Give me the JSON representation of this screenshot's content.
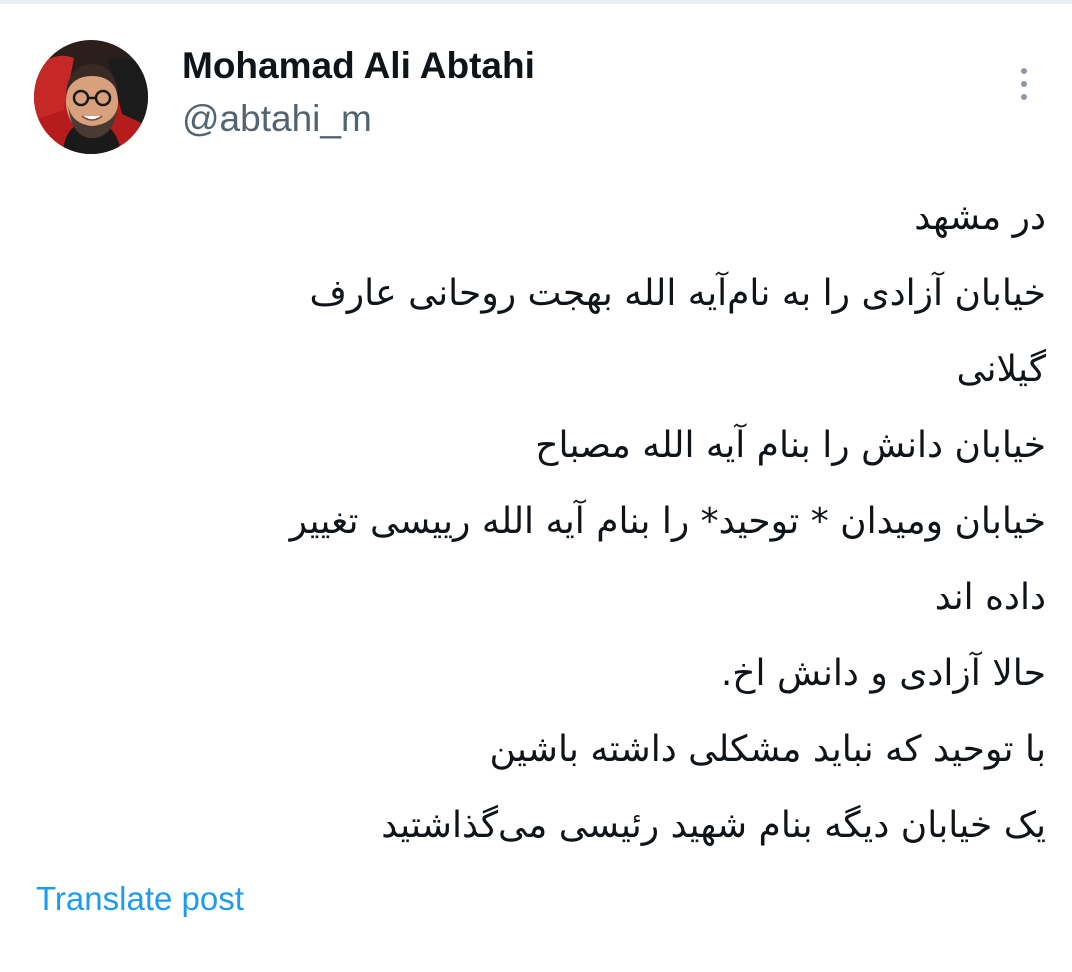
{
  "post": {
    "author": {
      "display_name": "Mohamad Ali Abtahi",
      "handle": "@abtahi_m",
      "avatar_icon": "profile-photo-avatar"
    },
    "more_icon": "more-vertical-icon",
    "text_lines": [
      "در مشهد",
      "خیابان آزادی را به نام‌آیه الله بهجت روحانی عارف",
      "گیلانی",
      "خیابان دانش را بنام آیه الله مصباح",
      "خیابان ومیدان * توحید* را بنام آیه الله رییسی تغییر",
      "داده اند",
      "حالا آزادی و دانش اخ.",
      "با توحید که نباید مشکلی داشته باشین",
      "یک خیابان دیگه بنام شهید رئیسی می‌گذاشتید"
    ],
    "translate_label": "Translate post"
  },
  "colors": {
    "text": "#0f1419",
    "secondary": "#536471",
    "link": "#1d9bf0",
    "icon": "#8b98a5"
  }
}
